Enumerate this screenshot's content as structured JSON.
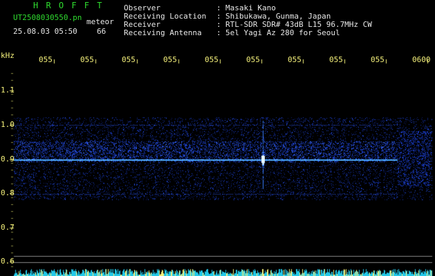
{
  "header": {
    "app_name": "H R O F F T",
    "filename": "UT2508030550.pn",
    "meteor_label": "meteor",
    "datetime": "25.08.03 05:50",
    "count": "66",
    "info": [
      {
        "label": "Observer",
        "sep": ":",
        "value": "Masaki Kano"
      },
      {
        "label": "Receiving Location",
        "sep": ":",
        "value": "Shibukawa, Gunma, Japan"
      },
      {
        "label": "Receiver",
        "sep": ":",
        "value": "RTL-SDR SDR# 43dB L15 96.7MHz CW"
      },
      {
        "label": "Receiving Antenna",
        "sep": ":",
        "value": "5el Yagi Az 280 for Seoul"
      }
    ]
  },
  "axis": {
    "unit": "kHz",
    "y_ticks": [
      "1.1",
      "1.0",
      "0.9",
      "0.8",
      "0.7",
      "0.6"
    ],
    "time_ticks": [
      "055",
      "055",
      "055",
      "055",
      "055",
      "055",
      "055",
      "055",
      "055",
      "0600"
    ]
  },
  "colors": {
    "background": "#000000",
    "header_text": "#2fdc2f",
    "time_text": "#f4f07a",
    "signal": "#3aa0ff",
    "noise": "#1a3cc8"
  }
}
